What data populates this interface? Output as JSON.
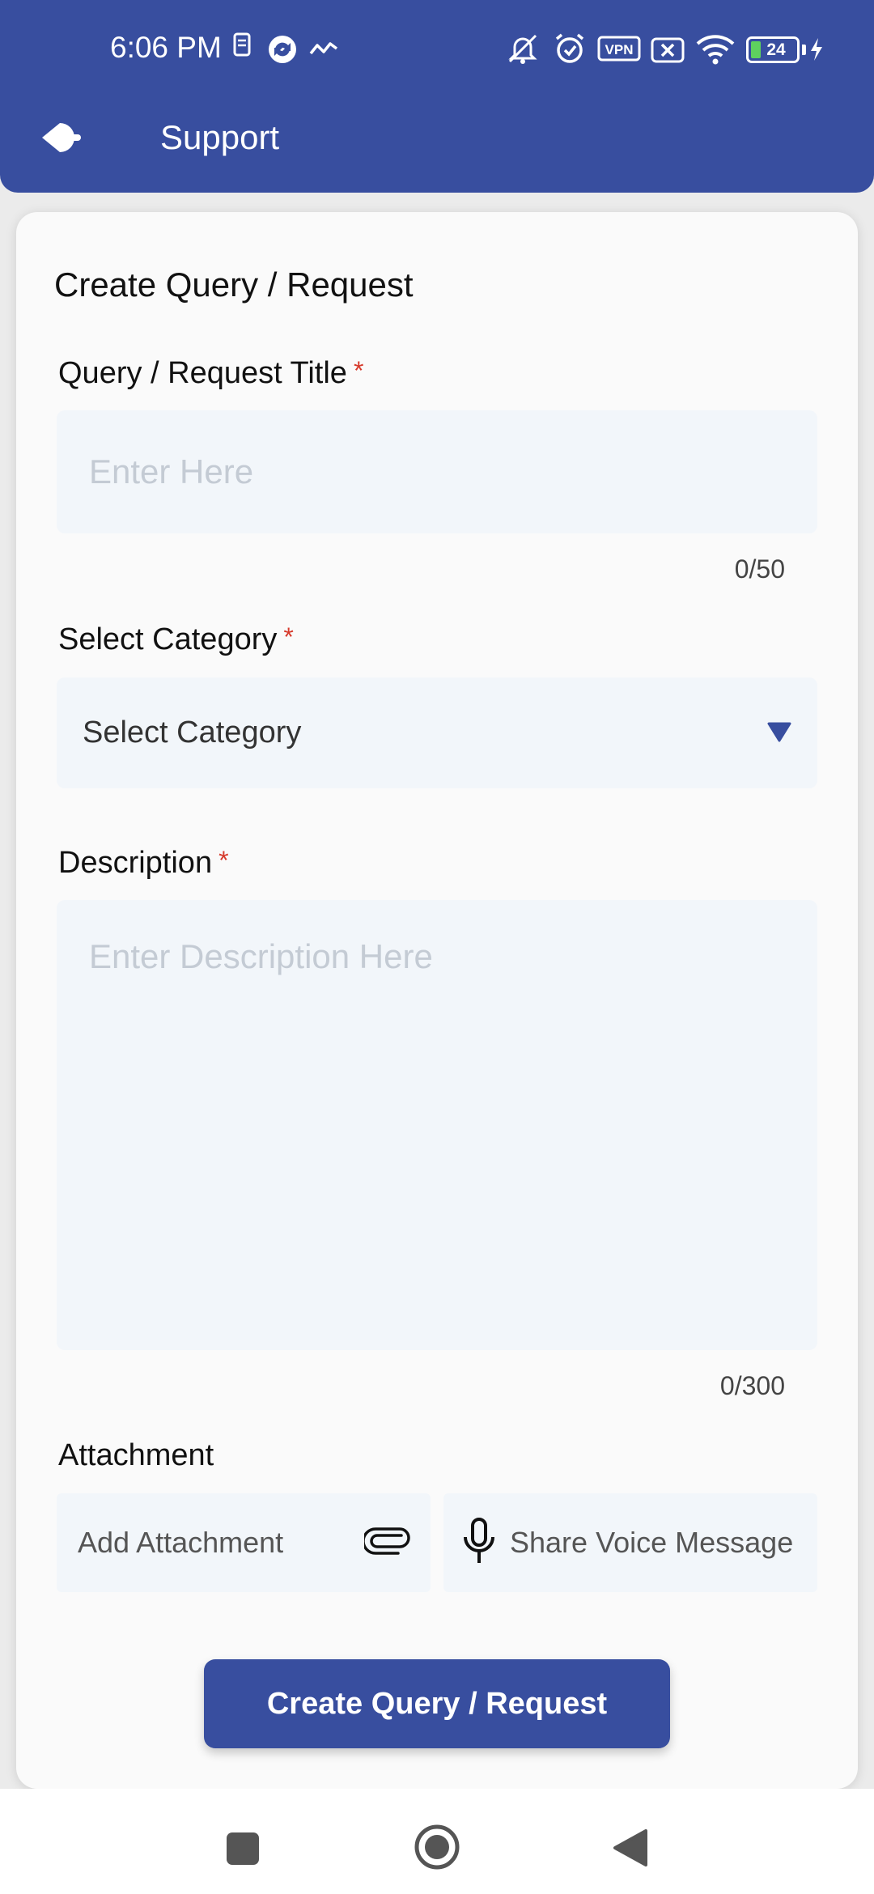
{
  "status_bar": {
    "time": "6:06 PM",
    "battery": "24",
    "vpn": "VPN",
    "icons": [
      "sim-icon",
      "sync-icon",
      "activity-icon",
      "mute-icon",
      "alarm-icon",
      "vpn-icon",
      "no-sim-icon",
      "wifi-icon",
      "battery-icon",
      "charging-icon"
    ]
  },
  "appbar": {
    "title": "Support",
    "back_icon": "back-arrow-icon",
    "color": "#384e9f"
  },
  "form": {
    "heading": "Create Query / Request",
    "title_label": "Query / Request Title",
    "title_placeholder": "Enter Here",
    "title_counter": "0/50",
    "category_label": "Select Category",
    "category_value": "Select Category",
    "description_label": "Description",
    "description_placeholder": "Enter Description Here",
    "description_counter": "0/300",
    "attachment_label": "Attachment",
    "add_attachment": "Add Attachment",
    "voice_message": "Share Voice Message",
    "required_mark": "*",
    "submit_label": "Create Query / Request",
    "accent": "#384e9f",
    "required_color": "#d63a2c"
  },
  "navbar": {
    "icons": [
      "recents-icon",
      "home-icon",
      "back-icon"
    ]
  }
}
